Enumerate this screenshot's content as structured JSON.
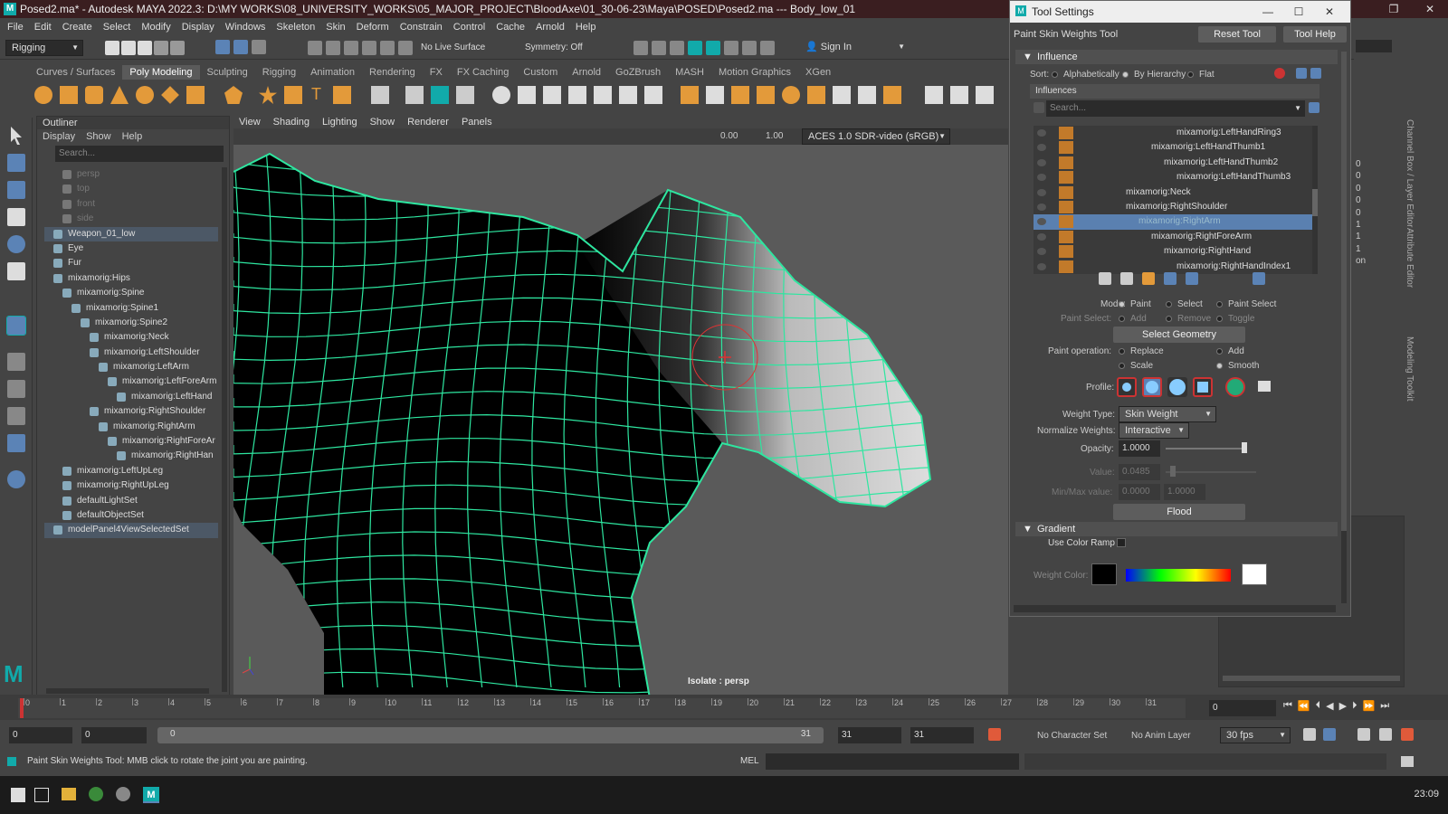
{
  "titlebar": {
    "title": "Posed2.ma* - Autodesk MAYA 2022.3: D:\\MY WORKS\\08_UNIVERSITY_WORKS\\05_MAJOR_PROJECT\\BloodAxe\\01_30-06-23\\Maya\\POSED\\Posed2.ma  ---  Body_low_01"
  },
  "menubar": [
    "File",
    "Edit",
    "Create",
    "Select",
    "Modify",
    "Display",
    "Windows",
    "Skeleton",
    "Skin",
    "Deform",
    "Constrain",
    "Control",
    "Cache",
    "Arnold",
    "Help"
  ],
  "statusline": {
    "menuset": "Rigging",
    "live_surface": "No Live Surface",
    "symmetry": "Symmetry: Off",
    "sign_in": "Sign In"
  },
  "shelf_tabs": [
    "Curves / Surfaces",
    "Poly Modeling",
    "Sculpting",
    "Rigging",
    "Animation",
    "Rendering",
    "FX",
    "FX Caching",
    "Custom",
    "Arnold",
    "GoZBrush",
    "MASH",
    "Motion Graphics",
    "XGen"
  ],
  "shelf_active": "Poly Modeling",
  "outliner": {
    "title": "Outliner",
    "menu": [
      "Display",
      "Show",
      "Help"
    ],
    "search_placeholder": "Search...",
    "items": [
      {
        "label": "persp",
        "indent": 1,
        "dim": true,
        "sel": false
      },
      {
        "label": "top",
        "indent": 1,
        "dim": true,
        "sel": false
      },
      {
        "label": "front",
        "indent": 1,
        "dim": true,
        "sel": false
      },
      {
        "label": "side",
        "indent": 1,
        "dim": true,
        "sel": false
      },
      {
        "label": "Weapon_01_low",
        "indent": 0,
        "dim": false,
        "sel": true
      },
      {
        "label": "Eye",
        "indent": 0,
        "dim": false,
        "sel": false
      },
      {
        "label": "Fur",
        "indent": 0,
        "dim": false,
        "sel": false
      },
      {
        "label": "mixamorig:Hips",
        "indent": 0,
        "dim": false,
        "sel": false
      },
      {
        "label": "mixamorig:Spine",
        "indent": 1,
        "dim": false,
        "sel": false
      },
      {
        "label": "mixamorig:Spine1",
        "indent": 2,
        "dim": false,
        "sel": false
      },
      {
        "label": "mixamorig:Spine2",
        "indent": 3,
        "dim": false,
        "sel": false
      },
      {
        "label": "mixamorig:Neck",
        "indent": 4,
        "dim": false,
        "sel": false
      },
      {
        "label": "mixamorig:LeftShoulder",
        "indent": 4,
        "dim": false,
        "sel": false
      },
      {
        "label": "mixamorig:LeftArm",
        "indent": 5,
        "dim": false,
        "sel": false
      },
      {
        "label": "mixamorig:LeftForeArm",
        "indent": 6,
        "dim": false,
        "sel": false
      },
      {
        "label": "mixamorig:LeftHand",
        "indent": 7,
        "dim": false,
        "sel": false
      },
      {
        "label": "mixamorig:RightShoulder",
        "indent": 4,
        "dim": false,
        "sel": false
      },
      {
        "label": "mixamorig:RightArm",
        "indent": 5,
        "dim": false,
        "sel": false
      },
      {
        "label": "mixamorig:RightForeAr",
        "indent": 6,
        "dim": false,
        "sel": false
      },
      {
        "label": "mixamorig:RightHan",
        "indent": 7,
        "dim": false,
        "sel": false
      },
      {
        "label": "mixamorig:LeftUpLeg",
        "indent": 1,
        "dim": false,
        "sel": false
      },
      {
        "label": "mixamorig:RightUpLeg",
        "indent": 1,
        "dim": false,
        "sel": false
      },
      {
        "label": "defaultLightSet",
        "indent": 1,
        "dim": false,
        "sel": false
      },
      {
        "label": "defaultObjectSet",
        "indent": 1,
        "dim": false,
        "sel": false
      },
      {
        "label": "modelPanel4ViewSelectedSet",
        "indent": 0,
        "dim": false,
        "sel": true
      }
    ]
  },
  "viewport": {
    "menu": [
      "View",
      "Shading",
      "Lighting",
      "Show",
      "Renderer",
      "Panels"
    ],
    "exposure": "0.00",
    "gamma": "1.00",
    "color_space": "ACES 1.0 SDR-video (sRGB)",
    "isolate_label": "Isolate : persp"
  },
  "tool_settings": {
    "window_title": "Tool Settings",
    "tool_name": "Paint Skin Weights Tool",
    "reset_tool": "Reset Tool",
    "tool_help": "Tool Help",
    "influence_section": "Influence",
    "sort_label": "Sort:",
    "sort_options": [
      "Alphabetically",
      "By Hierarchy",
      "Flat"
    ],
    "influences_header": "Influences",
    "search_placeholder": "Search...",
    "influences": [
      {
        "label": "mixamorig:LeftHandRing3",
        "indent": 7,
        "sel": false
      },
      {
        "label": "mixamorig:LeftHandThumb1",
        "indent": 5,
        "sel": false
      },
      {
        "label": "mixamorig:LeftHandThumb2",
        "indent": 6,
        "sel": false
      },
      {
        "label": "mixamorig:LeftHandThumb3",
        "indent": 7,
        "sel": false
      },
      {
        "label": "mixamorig:Neck",
        "indent": 3,
        "sel": false
      },
      {
        "label": "mixamorig:RightShoulder",
        "indent": 3,
        "sel": false
      },
      {
        "label": "mixamorig:RightArm",
        "indent": 4,
        "sel": true
      },
      {
        "label": "mixamorig:RightForeArm",
        "indent": 5,
        "sel": false
      },
      {
        "label": "mixamorig:RightHand",
        "indent": 6,
        "sel": false
      },
      {
        "label": "mixamorig:RightHandIndex1",
        "indent": 7,
        "sel": false
      }
    ],
    "mode_label": "Mode:",
    "mode_options": [
      "Paint",
      "Select",
      "Paint Select"
    ],
    "paint_select_label": "Paint Select:",
    "paint_select_options": [
      "Add",
      "Remove",
      "Toggle"
    ],
    "select_geometry": "Select Geometry",
    "paint_operation_label": "Paint operation:",
    "paint_operation_options": [
      "Replace",
      "Add",
      "Scale",
      "Smooth"
    ],
    "profile_label": "Profile:",
    "weight_type_label": "Weight Type:",
    "weight_type_value": "Skin Weight",
    "normalize_label": "Normalize Weights:",
    "normalize_value": "Interactive",
    "opacity_label": "Opacity:",
    "opacity_value": "1.0000",
    "opacity_level": 1.0,
    "value_label": "Value:",
    "value_value": "0.0485",
    "minmax_label": "Min/Max value:",
    "min_value": "0.0000",
    "max_value": "1.0000",
    "flood": "Flood",
    "gradient_section": "Gradient",
    "use_color_ramp": "Use Color Ramp",
    "weight_color_label": "Weight Color:"
  },
  "channel_box": {
    "values": [
      "0",
      "0",
      "0",
      "0",
      "0",
      "1",
      "1",
      "1",
      "on"
    ],
    "side_tabs": [
      "Channel Box / Layer Editor",
      "Attribute Editor",
      "Modeling Toolkit"
    ]
  },
  "timeline": {
    "ticks": [
      "0",
      "1",
      "2",
      "3",
      "4",
      "5",
      "6",
      "7",
      "8",
      "9",
      "10",
      "11",
      "12",
      "13",
      "14",
      "15",
      "16",
      "17",
      "18",
      "19",
      "20",
      "21",
      "22",
      "23",
      "24",
      "25",
      "26",
      "27",
      "28",
      "29",
      "30",
      "31"
    ],
    "current_frame": "0"
  },
  "rangebar": {
    "start": "0",
    "start2": "0",
    "range_start": "0",
    "range_end": "31",
    "end1": "31",
    "end2": "31",
    "character_set": "No Character Set",
    "anim_layer": "No Anim Layer",
    "fps": "30 fps"
  },
  "helpline": {
    "text": "Paint Skin Weights Tool: MMB click to rotate the joint you are painting.",
    "mel": "MEL"
  },
  "taskbar": {
    "clock": "23:09"
  },
  "colors": {
    "wire": "#2ee6a0",
    "selection": "#5a80b0",
    "influence_swatch": "#c27a2a"
  }
}
